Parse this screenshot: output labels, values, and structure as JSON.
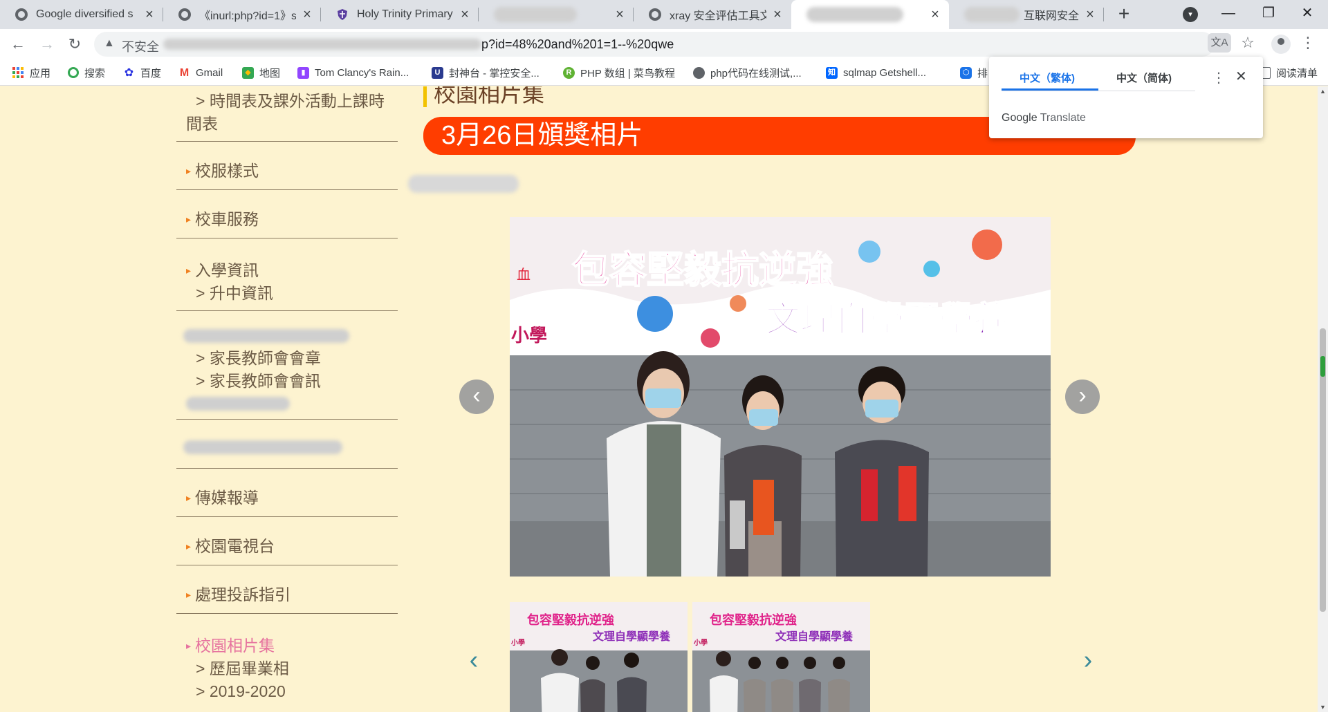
{
  "browser": {
    "tabs": [
      {
        "title": "Google diversified s",
        "favicon": "globe-icon",
        "active": false
      },
      {
        "title": "《inurl:php?id=1》s",
        "favicon": "globe-icon",
        "active": false
      },
      {
        "title": "Holy Trinity Primary",
        "favicon": "shield-icon",
        "active": false
      },
      {
        "title": "",
        "favicon": "blurred",
        "active": false
      },
      {
        "title": "xray 安全评估工具文",
        "favicon": "globe-icon",
        "active": false
      },
      {
        "title": "",
        "favicon": "blurred",
        "active": true
      },
      {
        "title": "互联网安全",
        "favicon": "blurred",
        "active": false
      }
    ],
    "address": {
      "security_label": "不安全",
      "url_visible": "p?id=48%20and%201=1--%20qwe"
    },
    "bookmarks": [
      {
        "label": "应用",
        "icon": "apps-icon"
      },
      {
        "label": "搜索",
        "icon": "search-icon"
      },
      {
        "label": "百度",
        "icon": "baidu-icon"
      },
      {
        "label": "Gmail",
        "icon": "gmail-icon"
      },
      {
        "label": "地图",
        "icon": "maps-icon"
      },
      {
        "label": "Tom Clancy's Rain...",
        "icon": "twitch-icon"
      },
      {
        "label": "封神台 - 掌控安全...",
        "icon": "shield-icon"
      },
      {
        "label": "PHP 数组 | 菜鸟教程",
        "icon": "runoob-icon"
      },
      {
        "label": "php代码在线测试,...",
        "icon": "globe-icon"
      },
      {
        "label": "sqlmap Getshell...",
        "icon": "zhihu-icon"
      },
      {
        "label": "排",
        "icon": "hex-icon"
      },
      {
        "label": "阅读清单",
        "icon": "reading-list-icon"
      }
    ]
  },
  "translate_popup": {
    "tab_traditional": "中文（繁体)",
    "tab_simplified": "中文（简体)",
    "brand_google": "Google",
    "brand_translate": "Translate"
  },
  "sidebar": {
    "groups": [
      {
        "items": [
          {
            "type": "sub-cont",
            "text": "> 時間表及課外活動上課時"
          },
          {
            "type": "cont",
            "text": "間表"
          }
        ]
      },
      {
        "items": [
          {
            "type": "main",
            "text": "校服樣式"
          }
        ]
      },
      {
        "items": [
          {
            "type": "main",
            "text": "校車服務"
          }
        ]
      },
      {
        "items": [
          {
            "type": "main",
            "text": "入學資訊"
          },
          {
            "type": "sub",
            "text": "> 升中資訊"
          }
        ]
      },
      {
        "items": [
          {
            "type": "blur"
          },
          {
            "type": "sub",
            "text": "> 家長教師會會章"
          },
          {
            "type": "sub",
            "text": "> 家長教師會會訊"
          },
          {
            "type": "blur"
          }
        ]
      },
      {
        "items": [
          {
            "type": "blur"
          }
        ]
      },
      {
        "items": [
          {
            "type": "main",
            "text": "傳媒報導"
          }
        ]
      },
      {
        "items": [
          {
            "type": "main",
            "text": "校園電視台"
          }
        ]
      },
      {
        "items": [
          {
            "type": "main",
            "text": "處理投訴指引"
          }
        ]
      },
      {
        "items": [
          {
            "type": "active",
            "text": "校園相片集"
          },
          {
            "type": "sub",
            "text": "> 歷屆畢業相"
          },
          {
            "type": "sub",
            "text": "> 2019-2020"
          }
        ]
      }
    ]
  },
  "main": {
    "section_title": "校園相片集",
    "album_title": "3月26日頒獎相片",
    "photo_banner_line1": "包容堅毅抗逆強",
    "photo_banner_line2": "文理自學顯學養",
    "photo_side_text": "小學",
    "photo_stamp": "血"
  },
  "colors": {
    "page_bg": "#fdf3d0",
    "banner": "#ff3d00",
    "link_text": "#6b5a45",
    "active_link": "#e6739f",
    "bullet": "#f08020"
  }
}
